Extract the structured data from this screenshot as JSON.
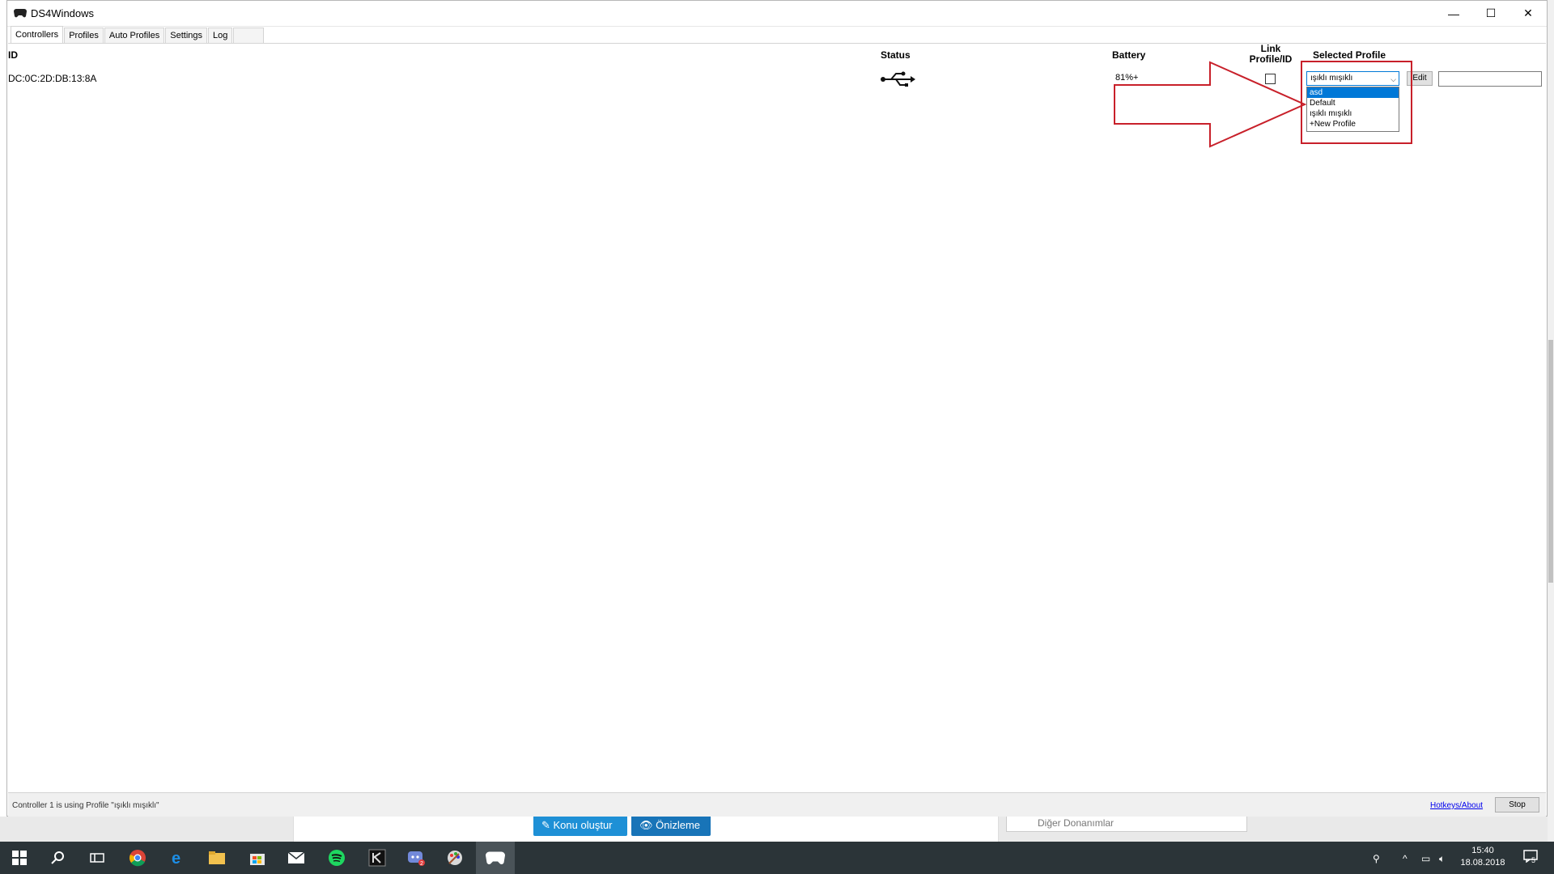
{
  "window": {
    "title": "DS4Windows",
    "minimize_glyph": "—",
    "maximize_glyph": "☐",
    "close_glyph": "✕"
  },
  "tabs": [
    {
      "label": "Controllers",
      "active": true
    },
    {
      "label": "Profiles",
      "active": false
    },
    {
      "label": "Auto Profiles",
      "active": false
    },
    {
      "label": "Settings",
      "active": false
    },
    {
      "label": "Log",
      "active": false
    }
  ],
  "grid": {
    "headers": {
      "id": "ID",
      "status": "Status",
      "battery": "Battery",
      "link_line1": "Link",
      "link_line2": "Profile/ID",
      "selected_profile": "Selected Profile"
    },
    "row": {
      "id": "DC:0C:2D:DB:13:8A",
      "status_icon": "usb-icon",
      "battery": "81%+",
      "link_checked": false,
      "selected_profile": "ışıklı mışıklı",
      "edit_label": "Edit",
      "id_field_value": ""
    }
  },
  "profile_dropdown": {
    "options": [
      "asd",
      "Default",
      "ışıklı mışıklı",
      "+New Profile"
    ],
    "highlighted": "asd"
  },
  "annotation": {
    "color": "#c8202a"
  },
  "statusbar": {
    "message": "Controller 1 is using Profile \"ışıklı mışıklı\"",
    "hotkeys_link": "Hotkeys/About",
    "stop_label": "Stop"
  },
  "background_page": {
    "create_topic_button": "Konu oluştur",
    "preview_button": "Önizleme",
    "category_field": "Diğer Donanımlar"
  },
  "taskbar": {
    "clock_time": "15:40",
    "clock_date": "18.08.2018",
    "notification_count": "5"
  },
  "colors": {
    "selection_blue": "#0078d7",
    "taskbar_bg": "#2b3438"
  }
}
